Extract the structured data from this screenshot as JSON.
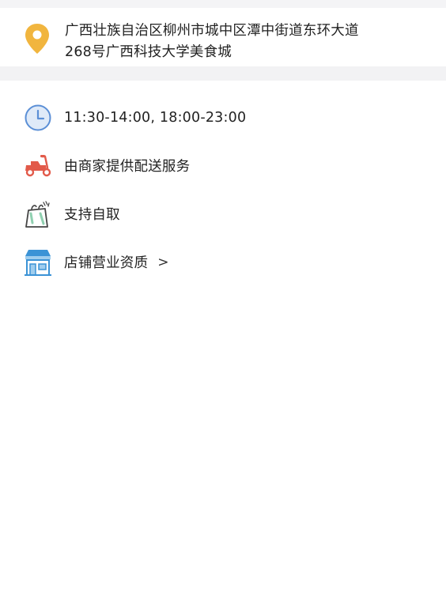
{
  "address": {
    "line1": "广西壮族自治区柳州市城中区潭中街道东环大道",
    "line2": "268号广西科技大学美食城",
    "icon": "location-pin-icon",
    "icon_color": "#f1b53e"
  },
  "info": {
    "hours": {
      "text": "11:30-14:00, 18:00-23:00",
      "icon": "clock-icon",
      "icon_color": "#5b8fd6"
    },
    "delivery": {
      "text": "由商家提供配送服务",
      "icon": "scooter-icon",
      "icon_color": "#e25a4a"
    },
    "pickup": {
      "text": "支持自取",
      "icon": "shopping-bag-icon",
      "icon_color": "#444444"
    },
    "license": {
      "text": "店铺营业资质",
      "chevron": ">",
      "icon": "storefront-icon",
      "icon_color": "#3b93d6"
    }
  }
}
